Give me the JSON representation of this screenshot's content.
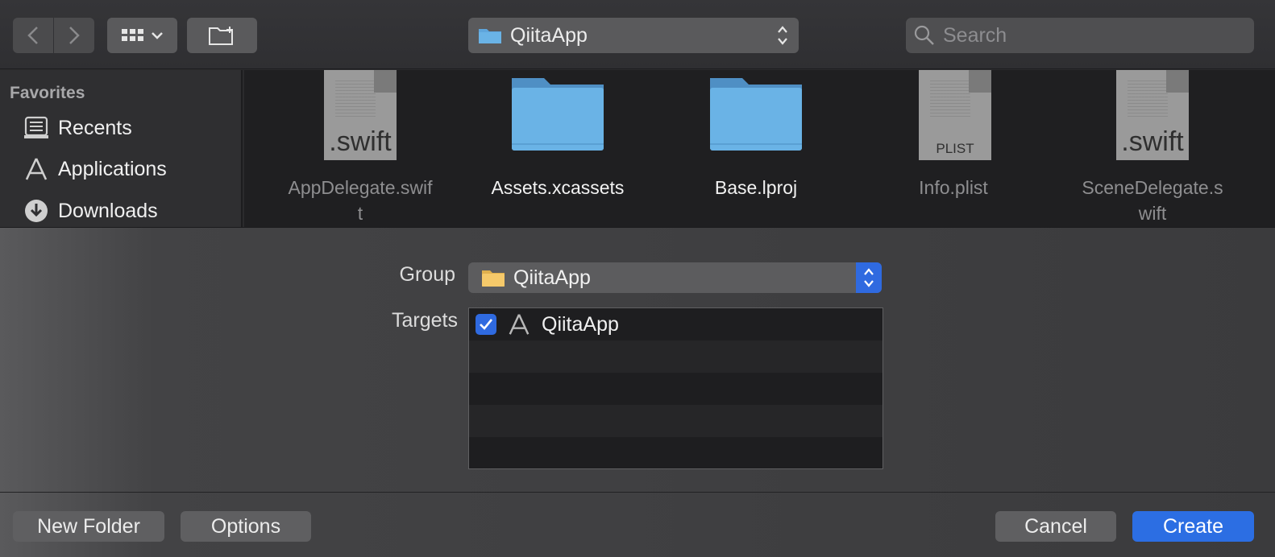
{
  "toolbar": {
    "location": "QiitaApp",
    "search_placeholder": "Search"
  },
  "sidebar": {
    "heading": "Favorites",
    "items": [
      {
        "label": "Recents",
        "icon": "recents-icon"
      },
      {
        "label": "Applications",
        "icon": "applications-icon"
      },
      {
        "label": "Downloads",
        "icon": "downloads-icon"
      }
    ]
  },
  "files": [
    {
      "name_line1": "AppDelegate.swif",
      "name_line2": "t",
      "kind": "swift-file",
      "ext": ".swift"
    },
    {
      "name_line1": "Assets.xcassets",
      "name_line2": "",
      "kind": "folder"
    },
    {
      "name_line1": "Base.lproj",
      "name_line2": "",
      "kind": "folder"
    },
    {
      "name_line1": "Info.plist",
      "name_line2": "",
      "kind": "plist-file",
      "ext": "PLIST"
    },
    {
      "name_line1": "SceneDelegate.s",
      "name_line2": "wift",
      "kind": "swift-file",
      "ext": ".swift"
    }
  ],
  "form": {
    "group_label": "Group",
    "group_value": "QiitaApp",
    "targets_label": "Targets",
    "targets": [
      {
        "name": "QiitaApp",
        "checked": true
      }
    ]
  },
  "buttons": {
    "new_folder": "New Folder",
    "options": "Options",
    "cancel": "Cancel",
    "create": "Create"
  },
  "colors": {
    "accent": "#2c6ee3",
    "folder_blue": "#6aaee0",
    "folder_yellow": "#f5c96a"
  }
}
